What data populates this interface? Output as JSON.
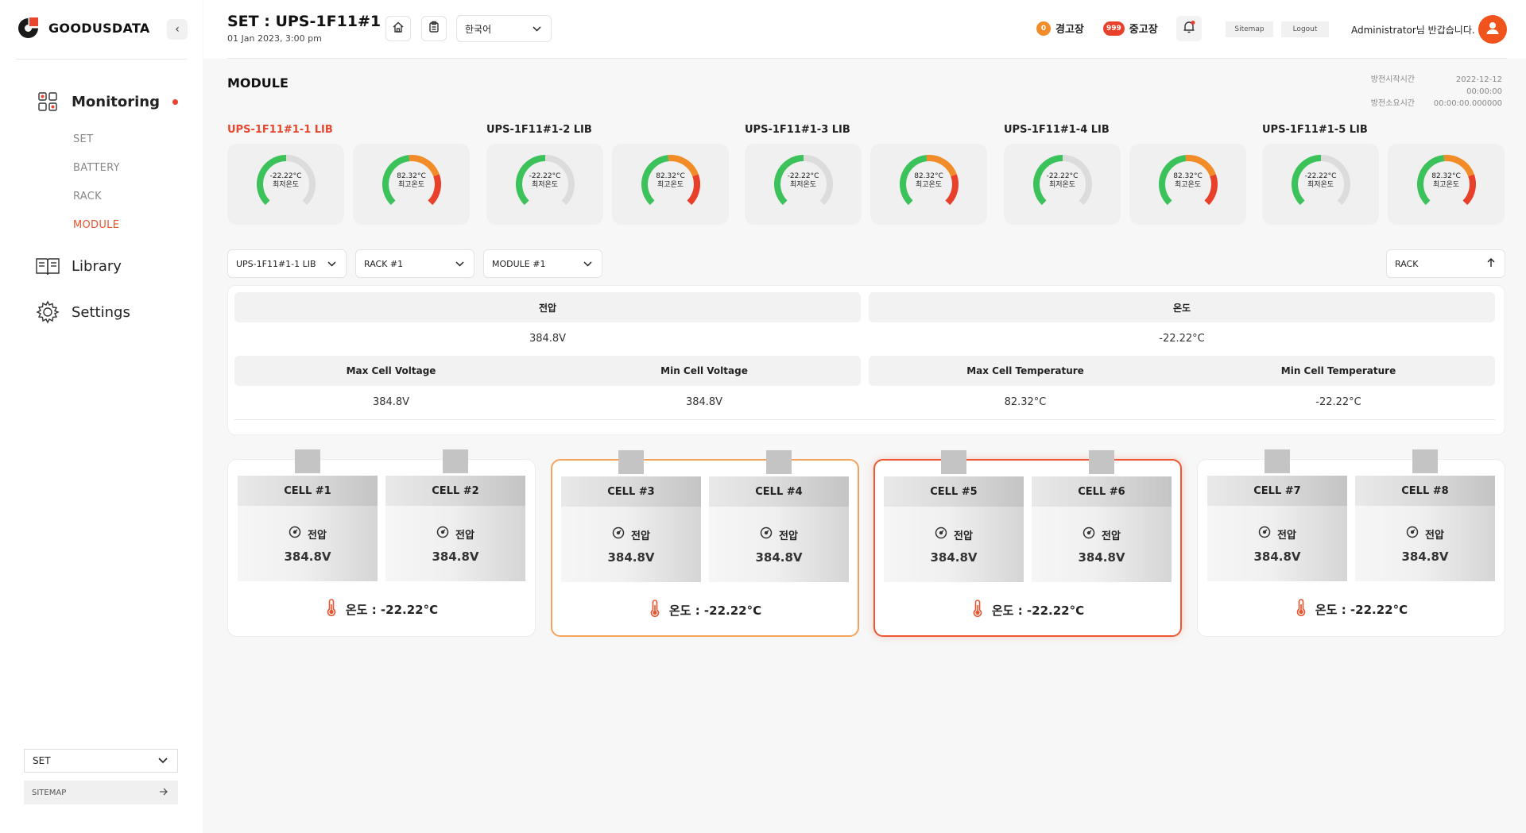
{
  "brand": {
    "name": "GOODUSDATA"
  },
  "sidebar": {
    "monitoring_label": "Monitoring",
    "sub_items": [
      "SET",
      "BATTERY",
      "RACK",
      "MODULE"
    ],
    "active_sub": "MODULE",
    "library_label": "Library",
    "settings_label": "Settings",
    "bottom_select": "SET",
    "sitemap_label": "SITEMAP"
  },
  "header": {
    "title": "SET : UPS-1F11#1",
    "date": "01 Jan 2023, 3:00 pm",
    "language": "한국어",
    "warning_count": "0",
    "warning_label": "경고장",
    "fault_count": "999",
    "fault_label": "중고장",
    "sitemap_btn": "Sitemap",
    "logout_btn": "Logout",
    "greeting": "Administrator님 반갑습니다."
  },
  "page": {
    "heading": "MODULE",
    "start_label": "방전시작시간",
    "start_value": "2022-12-12 00:00:00",
    "duration_label": "방전소요시간",
    "duration_value": "00:00:00.000000"
  },
  "libs": [
    {
      "title": "UPS-1F11#1-1 LIB",
      "active": true,
      "min_temp": "-22.22°C",
      "min_label": "최저온도",
      "max_temp": "82.32°C",
      "max_label": "최고온도"
    },
    {
      "title": "UPS-1F11#1-2 LIB",
      "active": false,
      "min_temp": "-22.22°C",
      "min_label": "최저온도",
      "max_temp": "82.32°C",
      "max_label": "최고온도"
    },
    {
      "title": "UPS-1F11#1-3 LIB",
      "active": false,
      "min_temp": "-22.22°C",
      "min_label": "최저온도",
      "max_temp": "82.32°C",
      "max_label": "최고온도"
    },
    {
      "title": "UPS-1F11#1-4 LIB",
      "active": false,
      "min_temp": "-22.22°C",
      "min_label": "최저온도",
      "max_temp": "82.32°C",
      "max_label": "최고온도"
    },
    {
      "title": "UPS-1F11#1-5 LIB",
      "active": false,
      "min_temp": "-22.22°C",
      "min_label": "최저온도",
      "max_temp": "82.32°C",
      "max_label": "최고온도"
    }
  ],
  "filters": {
    "lib": "UPS-1F11#1-1 LIB",
    "rack": "RACK #1",
    "module": "MODULE #1",
    "back": "RACK"
  },
  "summary": {
    "voltage_head": "전압",
    "voltage_value": "384.8V",
    "temp_head": "온도",
    "temp_value": "-22.22°C",
    "max_cell_voltage_head": "Max Cell Voltage",
    "max_cell_voltage": "384.8V",
    "min_cell_voltage_head": "Min Cell Voltage",
    "min_cell_voltage": "384.8V",
    "max_cell_temp_head": "Max Cell Temperature",
    "max_cell_temp": "82.32°C",
    "min_cell_temp_head": "Min Cell Temperature",
    "min_cell_temp": "-22.22°C"
  },
  "modules": [
    {
      "status": "normal",
      "temp_text": "온도 : -22.22°C",
      "cells": [
        {
          "name": "CELL #1",
          "volt_label": "전압",
          "volt": "384.8V"
        },
        {
          "name": "CELL #2",
          "volt_label": "전압",
          "volt": "384.8V"
        }
      ]
    },
    {
      "status": "warning",
      "temp_text": "온도 : -22.22°C",
      "cells": [
        {
          "name": "CELL #3",
          "volt_label": "전압",
          "volt": "384.8V"
        },
        {
          "name": "CELL #4",
          "volt_label": "전압",
          "volt": "384.8V"
        }
      ]
    },
    {
      "status": "fault",
      "temp_text": "온도 : -22.22°C",
      "cells": [
        {
          "name": "CELL #5",
          "volt_label": "전압",
          "volt": "384.8V"
        },
        {
          "name": "CELL #6",
          "volt_label": "전압",
          "volt": "384.8V"
        }
      ]
    },
    {
      "status": "normal",
      "temp_text": "온도 : -22.22°C",
      "cells": [
        {
          "name": "CELL #7",
          "volt_label": "전압",
          "volt": "384.8V"
        },
        {
          "name": "CELL #8",
          "volt_label": "전압",
          "volt": "384.8V"
        }
      ]
    }
  ],
  "colors": {
    "accent": "#e8462e",
    "warning": "#f5a25d",
    "fault": "#ee5533",
    "gauge_green": "#3cc25a",
    "gauge_orange": "#f28c28",
    "gauge_red": "#e8402a"
  }
}
